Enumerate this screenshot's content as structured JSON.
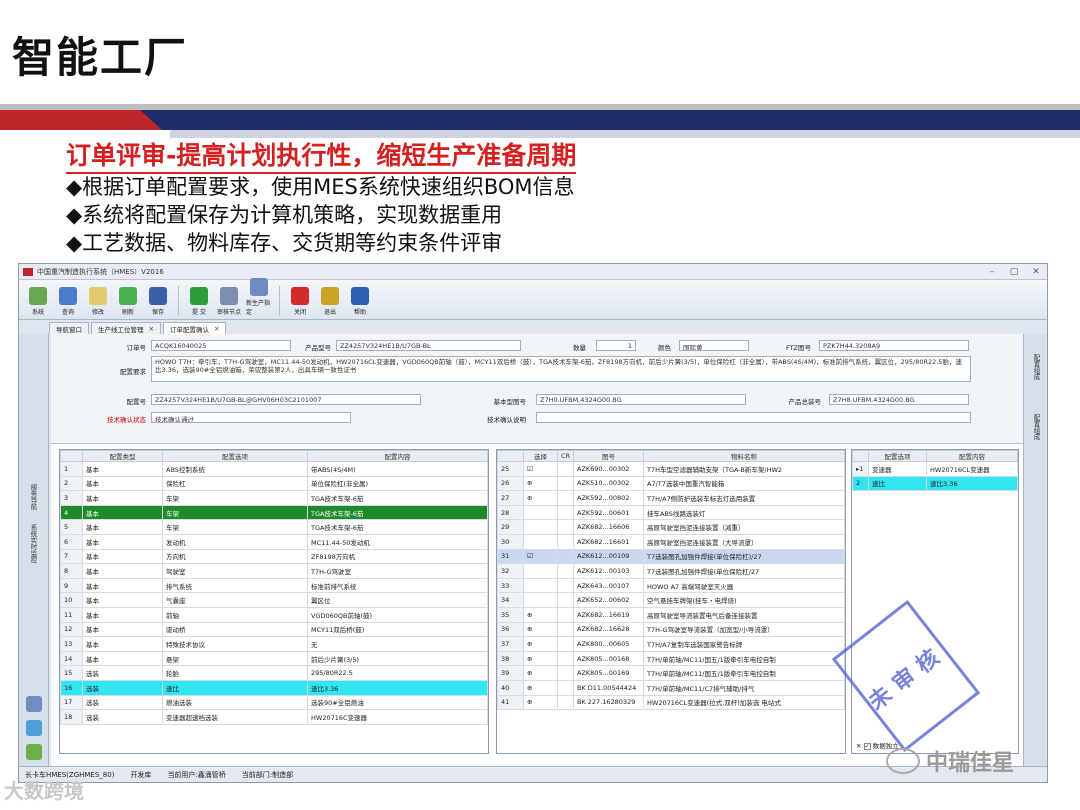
{
  "slide": {
    "title": "智能工厂",
    "subtitle": "订单评审-提高计划执行性，缩短生产准备周期",
    "bullets": [
      "◆根据订单配置要求，使用MES系统快速组织BOM信息",
      "◆系统将配置保存为计算机策略，实现数据重用",
      "◆工艺数据、物料库存、交货期等约束条件评审"
    ]
  },
  "app": {
    "window_title": "中国重汽制造执行系统（HMES）V2016",
    "toolbar": [
      {
        "label": "系统",
        "icon": "system-icon",
        "color": "#6aa84f"
      },
      {
        "label": "查询",
        "icon": "search-icon",
        "color": "#4a7cc9"
      },
      {
        "label": "修改",
        "icon": "edit-icon",
        "color": "#e6c86e"
      },
      {
        "label": "刷新",
        "icon": "refresh-icon",
        "color": "#4caf50"
      },
      {
        "label": "保存",
        "icon": "save-icon",
        "color": "#3c5fa8"
      },
      {
        "label": "提 交",
        "icon": "submit-icon",
        "color": "#2e9e3a"
      },
      {
        "label": "审核节点",
        "icon": "audit-node-icon",
        "color": "#7b8fb0"
      },
      {
        "label": "新生产指定",
        "icon": "new-production-icon",
        "color": "#6d8bc0"
      },
      {
        "label": "关闭",
        "icon": "close-icon",
        "color": "#d22b2b"
      },
      {
        "label": "退出",
        "icon": "exit-icon",
        "color": "#c9a227"
      },
      {
        "label": "帮助",
        "icon": "help-icon",
        "color": "#2d5fb3"
      }
    ],
    "tabs": [
      "导航窗口",
      "生产线工位管理",
      "订单配置确认"
    ],
    "left_rail": [
      "服务导航",
      "系统实时监控"
    ],
    "right_rail": [
      "配置组成",
      "配置组成"
    ],
    "form": {
      "order_no_label": "订单号",
      "order_no": "ACQK16040025",
      "product_model_label": "产品型号",
      "product_model": "ZZ4257V324HE1B/U7GB-BL",
      "quantity_label": "数量",
      "quantity": "1",
      "color_label": "颜色",
      "color": "国际黄",
      "ftz_label": "FTZ图号",
      "ftz": "PZK7H44.3208A9",
      "config_req_label": "配置要求",
      "config_req": "HOWO T7H：牵引车，T7H-G驾驶室，MC11.44-50发动机，HW20716CL变速器，VGD060QB前轴（鼓），MCY11双后桥（鼓），TGA技术车架-6茄，ZF8198方向机，前后少片簧(3/5)，单位保险杠（非全属），带ABS(4S/4M)，标准前排气系统，翼区位，295/80R22.5胎，速比3.36，选装90#全铝燃油箱，荣驭整装第2人，出具车辆一致性证书",
      "config_no_label": "配置号",
      "config_no": "ZZ4257V324HE1B/U7GB-BL@GHV06H03C2101007",
      "base_drawing_label": "基本型图号",
      "base_drawing": "Z7H0.UFBM.4324G00.BG",
      "product_assy_label": "产品总装号",
      "product_assy": "Z7H8.UFBM.4324G00.BG",
      "tech_status_label": "技术确认状态",
      "tech_status": "技术确认通过",
      "tech_note_label": "技术确认说明",
      "tech_note": ""
    },
    "config_table": {
      "headers": [
        "",
        "配置类型",
        "配置选项",
        "配置内容"
      ],
      "rows": [
        [
          "1",
          "基本",
          "ABS控制系统",
          "带ABS(4S/4M)"
        ],
        [
          "2",
          "基本",
          "保险杠",
          "单位保险杠(非全属)"
        ],
        [
          "3",
          "基本",
          "车架",
          "TGA技术车架-6茄"
        ],
        [
          "4",
          "基本",
          "车架",
          "TGA技术车架-6茄"
        ],
        [
          "5",
          "基本",
          "车架",
          "TGA技术车架-6茄"
        ],
        [
          "6",
          "基本",
          "发动机",
          "MC11.44-50发动机"
        ],
        [
          "7",
          "基本",
          "方向机",
          "ZF8198方向机"
        ],
        [
          "8",
          "基本",
          "驾驶室",
          "T7H-G驾驶室"
        ],
        [
          "9",
          "基本",
          "排气系统",
          "标准前排气系统"
        ],
        [
          "10",
          "基本",
          "气囊座",
          "翼区位"
        ],
        [
          "11",
          "基本",
          "前轴",
          "VGD060QB前轴(鼓)"
        ],
        [
          "12",
          "基本",
          "驱动桥",
          "MCY11双后桥(鼓)"
        ],
        [
          "13",
          "基本",
          "特殊技术协议",
          "无"
        ],
        [
          "14",
          "基本",
          "悬架",
          "前后少片簧(3/5)"
        ],
        [
          "15",
          "选装",
          "轮胎",
          "295/80R22.5"
        ],
        [
          "16",
          "选装",
          "速比",
          "速比3.36"
        ],
        [
          "17",
          "选装",
          "燃油选装",
          "选装90#全铝燃油"
        ],
        [
          "18",
          "选装",
          "变速器超速档选装",
          "HW20716C变速器"
        ]
      ],
      "green_row": 3,
      "cyan_row": 15
    },
    "material_table": {
      "headers": [
        "",
        "选择",
        "CR",
        "图号",
        "物料名称"
      ],
      "rows": [
        [
          "25",
          "☑",
          "",
          "AZK690...00302",
          "T7H车型空滤器辅助支架（TGA-B新车架/HW2"
        ],
        [
          "26",
          "⊕",
          "",
          "AZK510...00302",
          "A7/T7选装中国重汽智能箱"
        ],
        [
          "27",
          "⊕",
          "",
          "AZK592...00802",
          "T7H/A7侧防护选装车标志灯选用装置"
        ],
        [
          "28",
          "",
          "",
          "AZK592...00601",
          "挂车ABS线路选装灯"
        ],
        [
          "29",
          "",
          "",
          "AZK682...16606",
          "高原驾驶室挡泥连接装置（减重）"
        ],
        [
          "30",
          "",
          "",
          "AZK682...16601",
          "高原驾驶室挡泥连接装置（大导流罩）"
        ],
        [
          "31",
          "☑",
          "",
          "AZK612...00109",
          "T7选装图孔加强件焊接(单位保险杠)/27"
        ],
        [
          "32",
          "",
          "",
          "AZK612...00103",
          "T7选装图孔加强件焊接(单位保险杠/27"
        ],
        [
          "33",
          "",
          "",
          "AZK643...00107",
          "HOWO A7 高端驾驶室灭火器"
        ],
        [
          "34",
          "",
          "",
          "AZK652...00602",
          "空气悬挂车牌架(挂车・电焊烧)"
        ],
        [
          "35",
          "⊕",
          "",
          "AZK682...16619",
          "高原驾驶室导流装置电气后备连接装置"
        ],
        [
          "36",
          "⊕",
          "",
          "AZK682...16628",
          "T7H-G驾驶室导流装置（加宽型/小导流罩）"
        ],
        [
          "37",
          "⊕",
          "",
          "AZK800...00605",
          "T7H/A7复制车选装国家警告标牌"
        ],
        [
          "38",
          "⊕",
          "",
          "AZK805...00168",
          "T7H/单前轴/MC11/国五/1版牵引车电控自制"
        ],
        [
          "39",
          "⊕",
          "",
          "AZK805...00169",
          "T7H/单前轴/MC11/国五/1版牵引车电控自制"
        ],
        [
          "40",
          "⊕",
          "",
          "BK D11.00544424",
          "T7H/单前轴/MC11/C7排气辅助/排气"
        ],
        [
          "41",
          "⊕",
          "",
          "BK 227.16280329",
          "HW20716CL变速器(拉式,双杆)加装选 电站式"
        ]
      ],
      "selected_row": 6
    },
    "right_table": {
      "headers": [
        "",
        "配置选项",
        "配置内容"
      ],
      "rows": [
        [
          "▸1",
          "变速器",
          "HW20716CL变速器"
        ],
        [
          "2",
          "速比",
          "速比3.36"
        ]
      ],
      "cyan_row": 1,
      "footer": "数据独立"
    },
    "status": {
      "app_name": "长卡车HMES(ZGHMES_80)",
      "plant": "开发库",
      "user": "当前用户:鑫涌管桥",
      "dept": "当前部门:制造部"
    }
  },
  "stamp_text": "未审核",
  "watermark_bottom": "大数跨境",
  "watermark_right": "中瑞佳星",
  "colors": {
    "accent_red": "#c0252b",
    "navy": "#1f2d6b",
    "subtitle_red": "#d42020",
    "green_sel": "#1e8a2a",
    "cyan_sel": "#31e6f0"
  }
}
